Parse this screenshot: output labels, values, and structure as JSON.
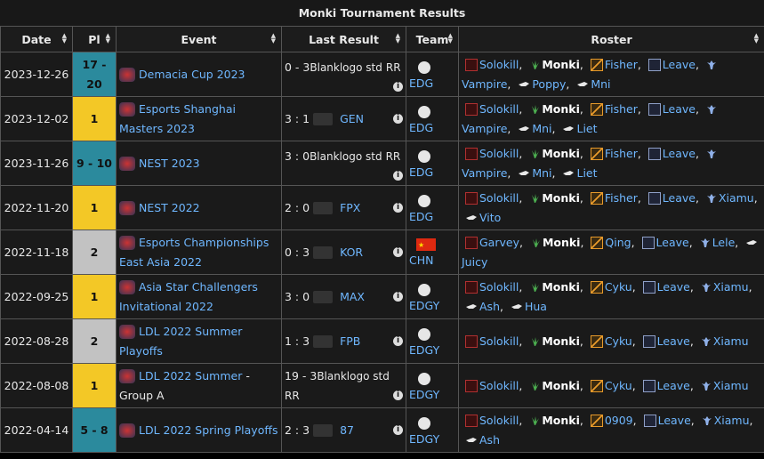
{
  "title": "Monki Tournament Results",
  "headers": {
    "date": "Date",
    "pl": "Pl",
    "event": "Event",
    "last_result": "Last Result",
    "team": "Team",
    "roster": "Roster"
  },
  "rows": [
    {
      "date": "2023-12-26",
      "pl": "17 - 20",
      "pl_style": "teal",
      "event": "Demacia Cup 2023",
      "score": "0 - 3",
      "opp_type": "broken",
      "opp_text": "Blanklogo std",
      "opp_suffix": "RR",
      "team": "EDG",
      "roster": [
        "Solokill",
        "Monki",
        "Fisher",
        "Leave",
        "Vampire",
        "Poppy",
        "Mni"
      ]
    },
    {
      "date": "2023-12-02",
      "pl": "1",
      "pl_style": "gold",
      "event": "Esports Shanghai Masters 2023",
      "score": "3 : 1",
      "opp_type": "logo",
      "opp_text": "GEN",
      "team": "EDG",
      "roster": [
        "Solokill",
        "Monki",
        "Fisher",
        "Leave",
        "Vampire",
        "Mni",
        "Liet"
      ]
    },
    {
      "date": "2023-11-26",
      "pl": "9 - 10",
      "pl_style": "teal",
      "event": "NEST 2023",
      "score": "3 : 0",
      "opp_type": "broken",
      "opp_text": "Blanklogo std",
      "opp_suffix": "RR",
      "team": "EDG",
      "roster": [
        "Solokill",
        "Monki",
        "Fisher",
        "Leave",
        "Vampire",
        "Mni",
        "Liet"
      ]
    },
    {
      "date": "2022-11-20",
      "pl": "1",
      "pl_style": "gold",
      "event": "NEST 2022",
      "score": "2 : 0",
      "opp_type": "logo",
      "opp_text": "FPX",
      "team": "EDG",
      "roster": [
        "Solokill",
        "Monki",
        "Fisher",
        "Leave",
        "Xiamu",
        "Vito"
      ]
    },
    {
      "date": "2022-11-18",
      "pl": "2",
      "pl_style": "silver",
      "event": "Esports Championships East Asia 2022",
      "score": "0 : 3",
      "opp_type": "logo",
      "opp_text": "KOR",
      "team": "CHN",
      "roster": [
        "Garvey",
        "Monki",
        "Qing",
        "Leave",
        "Lele",
        "Juicy"
      ]
    },
    {
      "date": "2022-09-25",
      "pl": "1",
      "pl_style": "gold",
      "event": "Asia Star Challengers Invitational 2022",
      "score": "3 : 0",
      "opp_type": "logo",
      "opp_text": "MAX",
      "team": "EDGY",
      "roster": [
        "Solokill",
        "Monki",
        "Cyku",
        "Leave",
        "Xiamu",
        "Ash",
        "Hua"
      ]
    },
    {
      "date": "2022-08-28",
      "pl": "2",
      "pl_style": "silver",
      "event": "LDL 2022 Summer Playoffs",
      "score": "1 : 3",
      "opp_type": "logo",
      "opp_text": "FPB",
      "team": "EDGY",
      "roster": [
        "Solokill",
        "Monki",
        "Cyku",
        "Leave",
        "Xiamu"
      ]
    },
    {
      "date": "2022-08-08",
      "pl": "1",
      "pl_style": "gold",
      "event": "LDL 2022 Summer",
      "event_suffix": " - Group A",
      "score": "19 - 3",
      "opp_type": "broken",
      "opp_text": "Blanklogo std",
      "opp_suffix": "RR",
      "team": "EDGY",
      "roster": [
        "Solokill",
        "Monki",
        "Cyku",
        "Leave",
        "Xiamu"
      ]
    },
    {
      "date": "2022-04-14",
      "pl": "5 - 8",
      "pl_style": "teal",
      "event": "LDL 2022 Spring Playoffs",
      "score": "2 : 3",
      "opp_type": "logo",
      "opp_text": "87",
      "team": "EDGY",
      "roster": [
        "Solokill",
        "Monki",
        "0909",
        "Leave",
        "Xiamu",
        "Ash"
      ]
    }
  ],
  "role_icons": [
    "top-icon",
    "jungle-icon",
    "mid-icon",
    "bot-icon",
    "support-icon",
    "coach-icon"
  ],
  "colors": {
    "teal": "#2b8a9d",
    "gold": "#f3c826",
    "silver": "#c2c2c2",
    "link": "#6fb7ff"
  }
}
